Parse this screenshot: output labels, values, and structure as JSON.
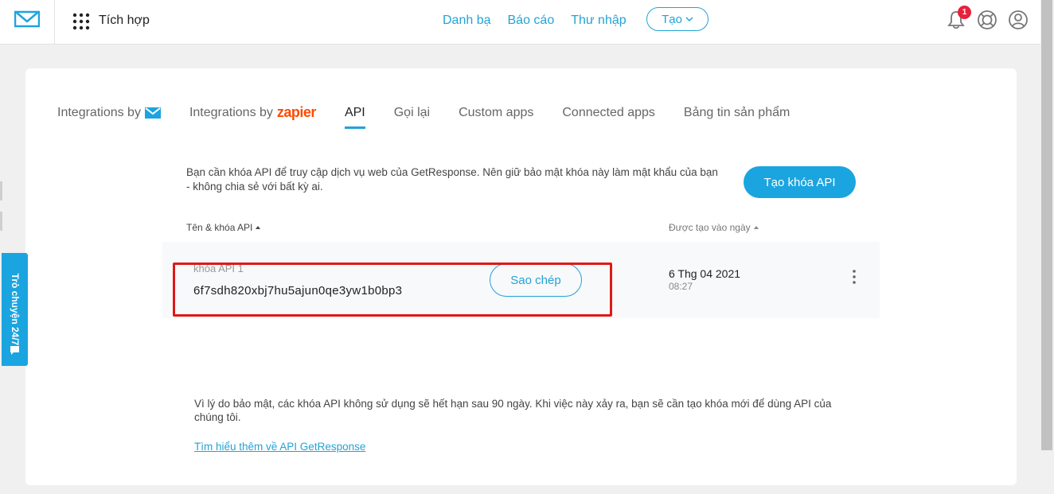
{
  "header": {
    "app_title": "Tích hợp",
    "nav": [
      "Danh bạ",
      "Báo cáo",
      "Thư nhập"
    ],
    "create_label": "Tạo",
    "notification_count": "1"
  },
  "tabs": [
    {
      "label": "Integrations by",
      "active": false
    },
    {
      "label": "Integrations by",
      "brand": "zapier",
      "active": false
    },
    {
      "label": "API",
      "active": true
    },
    {
      "label": "Gọi lại",
      "active": false
    },
    {
      "label": "Custom apps",
      "active": false
    },
    {
      "label": "Connected apps",
      "active": false
    },
    {
      "label": "Bảng tin sản phẩm",
      "active": false
    }
  ],
  "intro_text": "Bạn cần khóa API để truy cập dịch vụ web của GetResponse. Nên giữ bảo mật khóa này làm mật khẩu của bạn - không chia sẻ với bất kỳ ai.",
  "create_api_button": "Tạo khóa API",
  "table": {
    "col_name": "Tên & khóa API",
    "col_date": "Được tạo vào ngày",
    "rows": [
      {
        "name": "khóa API 1",
        "key": "6f7sdh820xbj7hu5ajun0qe3yw1b0bp3",
        "copy_label": "Sao chép",
        "date": "6 Thg 04 2021",
        "time": "08:27"
      }
    ]
  },
  "note": "Vì lý do bảo mật, các khóa API không sử dụng sẽ hết hạn sau 90 ngày. Khi việc này xảy ra, bạn sẽ cần tạo khóa mới để dùng API của chúng tôi.",
  "learn_more_link": "Tìm hiểu thêm về API GetResponse",
  "chat_label": "Trò chuyện 24/7",
  "colors": {
    "accent": "#1aa5e0",
    "highlight": "#e01818",
    "badge": "#e8213a",
    "zapier": "#ff4a00"
  }
}
